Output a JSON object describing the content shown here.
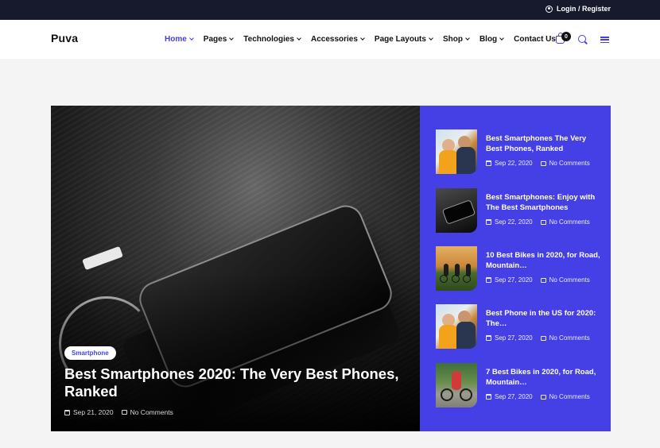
{
  "topbar": {
    "login_label": "Login / Register",
    "icon": "user-icon"
  },
  "header": {
    "logo": "Puva",
    "nav": [
      {
        "label": "Home",
        "active": true
      },
      {
        "label": "Pages"
      },
      {
        "label": "Technologies"
      },
      {
        "label": "Accessories"
      },
      {
        "label": "Page Layouts"
      },
      {
        "label": "Shop"
      },
      {
        "label": "Blog"
      },
      {
        "label": "Contact Us"
      }
    ],
    "cart_count": "0",
    "icons": [
      "cart-icon",
      "search-icon",
      "menu-icon"
    ]
  },
  "colors": {
    "accent": "#4540e6",
    "topbar": "#161a2c",
    "background": "#f4f4f5"
  },
  "hero": {
    "tag": "Smartphone",
    "title": "Best Smartphones 2020: The Very Best Phones, Ranked",
    "date": "Sep 21, 2020",
    "comments": "No Comments"
  },
  "side_posts": [
    {
      "title": "Best Smartphones The Very Best Phones, Ranked",
      "date": "Sep 22, 2020",
      "comments": "No Comments"
    },
    {
      "title": "Best Smartphones: Enjoy with The Best Smartphones",
      "date": "Sep 22, 2020",
      "comments": "No Comments"
    },
    {
      "title": "10 Best Bikes in 2020, for Road, Mountain…",
      "date": "Sep 27, 2020",
      "comments": "No Comments"
    },
    {
      "title": "Best Phone in the US for 2020: The…",
      "date": "Sep 27, 2020",
      "comments": "No Comments"
    },
    {
      "title": "7 Best Bikes in 2020, for Road, Mountain…",
      "date": "Sep 27, 2020",
      "comments": "No Comments"
    }
  ]
}
